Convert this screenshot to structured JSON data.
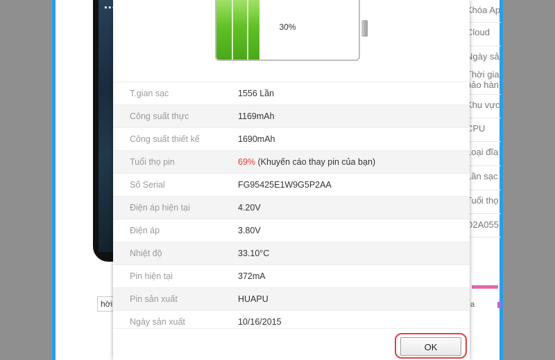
{
  "background_app": {
    "right_list": [
      "Khóa Ap",
      "Cloud",
      "Ngày sả",
      "Thời gia bảo hàn",
      "Khu vực",
      "CPU",
      "Loại đĩa",
      "Lần sạc",
      "Tuổi thọ",
      "D2A055"
    ],
    "left_input_text": "hời"
  },
  "dialog": {
    "battery_percent": "30%",
    "battery_level_fraction": 0.3,
    "rows": [
      {
        "label": "T.gian sạc",
        "value": "1556 Lần"
      },
      {
        "label": "Công suất thực",
        "value": "1169mAh"
      },
      {
        "label": "Công suất thiết kế",
        "value": "1690mAh"
      },
      {
        "label": "Tuổi thọ pin",
        "value_highlight": "69%",
        "value": " (Khuyến cáo thay pin của bạn)"
      },
      {
        "label": "Số Serial",
        "value": "FG95425E1W9G5P2AA"
      },
      {
        "label": "Điện áp hiện tại",
        "value": "4.20V"
      },
      {
        "label": "Điện áp",
        "value": "3.80V"
      },
      {
        "label": "Nhiệt độ",
        "value": "33.10°C"
      },
      {
        "label": "Pin hiện tại",
        "value": "372mA"
      },
      {
        "label": "Pin sản xuất",
        "value": "HUAPU"
      },
      {
        "label": "Ngày sản xuất",
        "value": "10/16/2015"
      }
    ],
    "ok_label": "OK"
  },
  "colors": {
    "battery_green": "#62c126",
    "warning_red": "#e53935",
    "highlight_ring": "#e04040",
    "frame_blue": "#2a9ee8"
  }
}
